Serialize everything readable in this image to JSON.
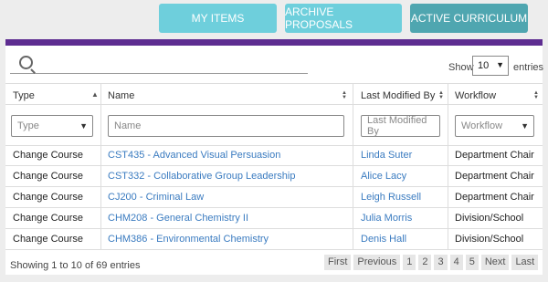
{
  "top_buttons": {
    "my_items": "MY ITEMS",
    "archive": "ARCHIVE PROPOSALS",
    "active": "ACTIVE CURRICULUM"
  },
  "search": {
    "placeholder": ""
  },
  "length": {
    "show_label": "Show",
    "value": "10",
    "entries_label": "entries"
  },
  "columns": [
    "Type",
    "Name",
    "Last Modified By",
    "Workflow"
  ],
  "filters": {
    "type": "Type",
    "name": "Name",
    "modified": "Last Modified By",
    "workflow": "Workflow"
  },
  "rows": [
    {
      "type": "Change Course",
      "name": "CST435 - Advanced Visual Persuasion",
      "modified": "Linda Suter",
      "workflow": "Department Chair"
    },
    {
      "type": "Change Course",
      "name": "CST332 - Collaborative Group Leadership",
      "modified": "Alice Lacy",
      "workflow": "Department Chair"
    },
    {
      "type": "Change Course",
      "name": "CJ200 - Criminal Law",
      "modified": "Leigh Russell",
      "workflow": "Department Chair"
    },
    {
      "type": "Change Course",
      "name": "CHM208 - General Chemistry II",
      "modified": "Julia Morris",
      "workflow": "Division/School"
    },
    {
      "type": "Change Course",
      "name": "CHM386 - Environmental Chemistry",
      "modified": "Denis Hall",
      "workflow": "Division/School"
    }
  ],
  "info": "Showing 1 to 10 of 69 entries",
  "pagination": {
    "first": "First",
    "previous": "Previous",
    "pages": [
      "1",
      "2",
      "3",
      "4",
      "5"
    ],
    "next": "Next",
    "last": "Last"
  },
  "colors": {
    "accent": "#5e2d91",
    "button": "#6ecfdc",
    "button_active": "#4fa6b0",
    "link": "#3a7bc0"
  }
}
